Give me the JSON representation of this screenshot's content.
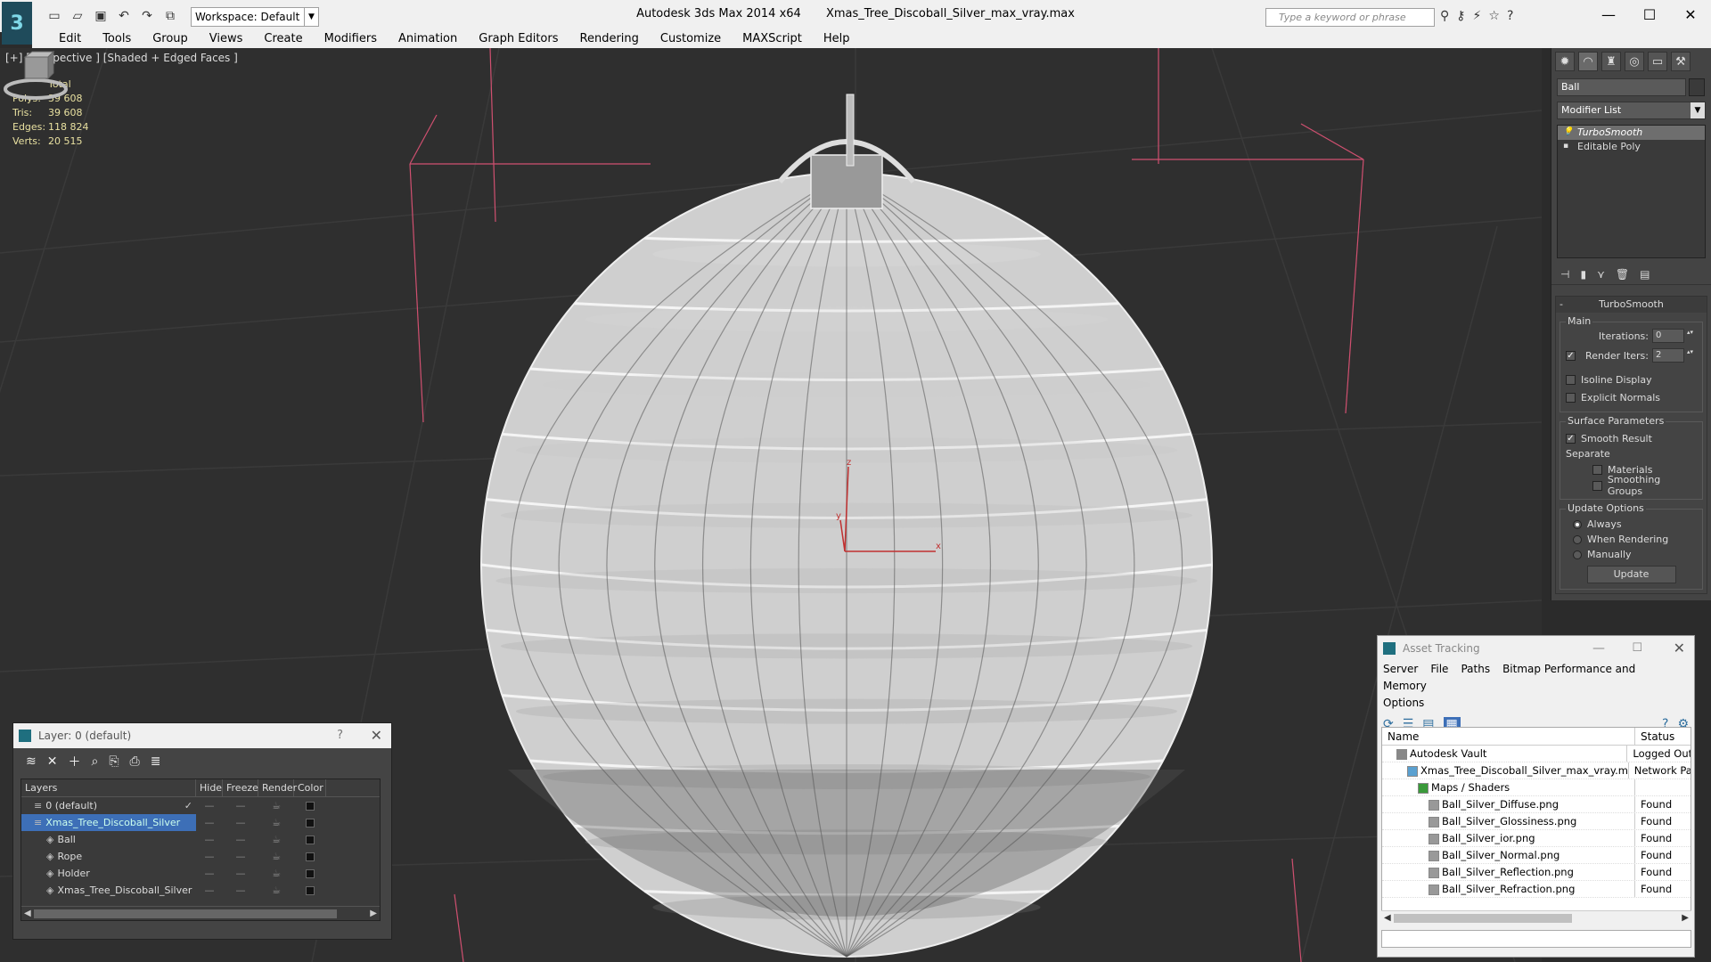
{
  "window": {
    "app_title": "Autodesk 3ds Max  2014 x64",
    "file_title": "Xmas_Tree_Discoball_Silver_max_vray.max",
    "workspace": "Workspace: Default",
    "search_placeholder": "Type a keyword or phrase"
  },
  "menu": [
    "Edit",
    "Tools",
    "Group",
    "Views",
    "Create",
    "Modifiers",
    "Animation",
    "Graph Editors",
    "Rendering",
    "Customize",
    "MAXScript",
    "Help"
  ],
  "viewport": {
    "label": "[+] [Perspective ] [Shaded + Edged Faces ]",
    "stats_total": "Total",
    "stats": [
      {
        "k": "Polys:",
        "v": "39 608"
      },
      {
        "k": "Tris:",
        "v": "39 608"
      },
      {
        "k": "Edges:",
        "v": "118 824"
      },
      {
        "k": "Verts:",
        "v": "20 515"
      }
    ],
    "axis_x": "x",
    "axis_y": "y",
    "axis_z": "z"
  },
  "command_panel": {
    "object_name": "Ball",
    "modifier_list": "Modifier List",
    "stack": [
      "TurboSmooth",
      "Editable Poly"
    ],
    "rollout_title": "TurboSmooth",
    "main_label": "Main",
    "iterations_label": "Iterations:",
    "iterations_value": "0",
    "render_iters_label": "Render Iters:",
    "render_iters_value": "2",
    "isoline_label": "Isoline Display",
    "explicit_label": "Explicit Normals",
    "surface_label": "Surface Parameters",
    "smooth_result_label": "Smooth Result",
    "separate_label": "Separate",
    "materials_label": "Materials",
    "smoothing_groups_label": "Smoothing Groups",
    "update_options_label": "Update Options",
    "always_label": "Always",
    "when_rendering_label": "When Rendering",
    "manually_label": "Manually",
    "update_button": "Update"
  },
  "layer_dialog": {
    "title": "Layer: 0 (default)",
    "help": "?",
    "columns": [
      "Layers",
      "Hide",
      "Freeze",
      "Render",
      "Color"
    ],
    "rows": [
      {
        "name": "0 (default)",
        "indent": 1,
        "selected": false,
        "color": "#111111"
      },
      {
        "name": "Xmas_Tree_Discoball_Silver",
        "indent": 1,
        "selected": true,
        "color": "#111111"
      },
      {
        "name": "Ball",
        "indent": 2,
        "selected": false,
        "color": "#111111"
      },
      {
        "name": "Rope",
        "indent": 2,
        "selected": false,
        "color": "#111111"
      },
      {
        "name": "Holder",
        "indent": 2,
        "selected": false,
        "color": "#111111"
      },
      {
        "name": "Xmas_Tree_Discoball_Silver",
        "indent": 2,
        "selected": false,
        "color": "#111111"
      }
    ]
  },
  "asset_tracking": {
    "title": "Asset Tracking",
    "menu": [
      "Server",
      "File",
      "Paths",
      "Bitmap Performance and Memory"
    ],
    "menu2": "Options",
    "columns": [
      "Name",
      "Status"
    ],
    "rows": [
      {
        "name": "Autodesk Vault",
        "status": "Logged Out",
        "indent": 1
      },
      {
        "name": "Xmas_Tree_Discoball_Silver_max_vray.max",
        "status": "Network Pa",
        "indent": 2
      },
      {
        "name": "Maps / Shaders",
        "status": "",
        "indent": 3
      },
      {
        "name": "Ball_Silver_Diffuse.png",
        "status": "Found",
        "indent": 4
      },
      {
        "name": "Ball_Silver_Glossiness.png",
        "status": "Found",
        "indent": 4
      },
      {
        "name": "Ball_Silver_ior.png",
        "status": "Found",
        "indent": 4
      },
      {
        "name": "Ball_Silver_Normal.png",
        "status": "Found",
        "indent": 4
      },
      {
        "name": "Ball_Silver_Reflection.png",
        "status": "Found",
        "indent": 4
      },
      {
        "name": "Ball_Silver_Refraction.png",
        "status": "Found",
        "indent": 4
      }
    ]
  },
  "colors": {
    "accent": "#3d6fb7",
    "viewport_bg": "#2f2f2f",
    "bbox_lines": "#d05070"
  }
}
